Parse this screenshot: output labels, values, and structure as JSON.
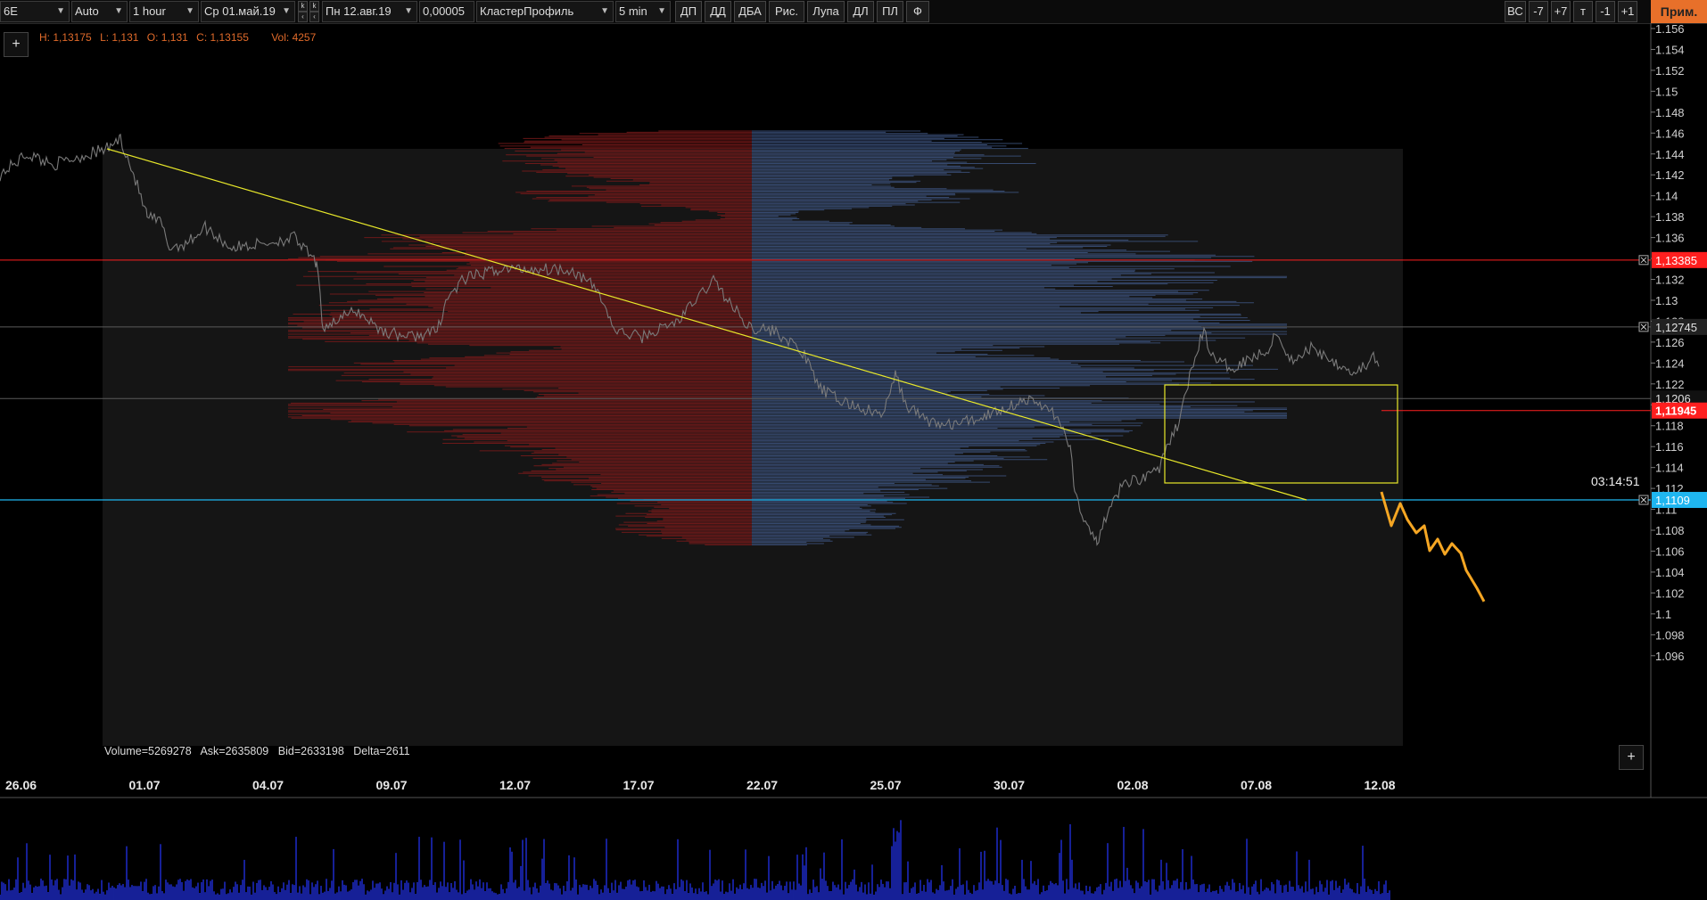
{
  "toolbar": {
    "symbol": "6E",
    "scale_mode": "Auto",
    "timeframe": "1 hour",
    "date_from": "Ср 01.май.19",
    "date_to": "Пн 12.авг.19",
    "tick_size": "0,00005",
    "profile_type": "КластерПрофиль",
    "profile_period": "5 min",
    "buttons": [
      "ДП",
      "ДД",
      "ДБА",
      "Рис.",
      "Лупа",
      "ДЛ",
      "ПЛ",
      "Ф"
    ],
    "spin_label": "k",
    "right_buttons": [
      "ВС",
      "-7",
      "+7",
      "т",
      "-1",
      "+1"
    ],
    "apply": "Прим."
  },
  "ohlc": {
    "high": "H: 1,13175",
    "low": "L: 1,131",
    "open": "O: 1,131",
    "close": "C: 1,13155",
    "vol": "Vol: 4257"
  },
  "stats": {
    "volume": "Volume=5269278",
    "ask": "Ask=2635809",
    "bid": "Bid=2633198",
    "delta": "Delta=2611"
  },
  "timer": "03:14:51",
  "plus_label": "+",
  "price_axis": {
    "ticks": [
      "1.156",
      "1.154",
      "1.152",
      "1.15",
      "1.148",
      "1.146",
      "1.144",
      "1.142",
      "1.14",
      "1.138",
      "1.136",
      "1.134",
      "1.132",
      "1.13",
      "1.128",
      "1.126",
      "1.124",
      "1.122",
      "1.12",
      "1.118",
      "1.116",
      "1.114",
      "1.112",
      "1.11",
      "1.108",
      "1.106",
      "1.104",
      "1.102",
      "1.1",
      "1.098",
      "1.096"
    ],
    "level_labels": {
      "red_level": "1,13385",
      "gray_level": "1,12745",
      "gray_level2": "1,1206",
      "current_price": "1,11945",
      "blue_level": "1,1109"
    }
  },
  "time_axis": {
    "labels": [
      "26.06",
      "01.07",
      "04.07",
      "09.07",
      "12.07",
      "17.07",
      "22.07",
      "25.07",
      "30.07",
      "02.08",
      "07.08",
      "12.08"
    ]
  },
  "colors": {
    "background": "#000000",
    "price_line": "#7a7a7a",
    "profile_bid": "#7a1a1a",
    "profile_ask": "#3a4f78",
    "red_level": "#ff1f1f",
    "blue_level": "#1fb6f0",
    "trendline": "#e8e82a",
    "projection": "#f5a623",
    "volume": "#1f2fd8",
    "ohlc_text": "#e06a2a"
  },
  "chart_data": {
    "type": "line",
    "title": "",
    "xlabel": "",
    "ylabel": "",
    "ylim": [
      1.096,
      1.1565
    ],
    "x": [
      "26.06",
      "01.07",
      "04.07",
      "09.07",
      "12.07",
      "17.07",
      "22.07",
      "25.07",
      "30.07",
      "02.08",
      "07.08",
      "12.08"
    ],
    "series": [
      {
        "values": [
          1.144,
          1.144,
          1.135,
          1.127,
          1.132,
          1.1265,
          1.1255,
          1.1195,
          1.1195,
          1.1095,
          1.124,
          1.1225
        ]
      }
    ],
    "horizontal_levels": [
      1.13385,
      1.12745,
      1.1206,
      1.11945,
      1.1109
    ],
    "grid": false
  }
}
